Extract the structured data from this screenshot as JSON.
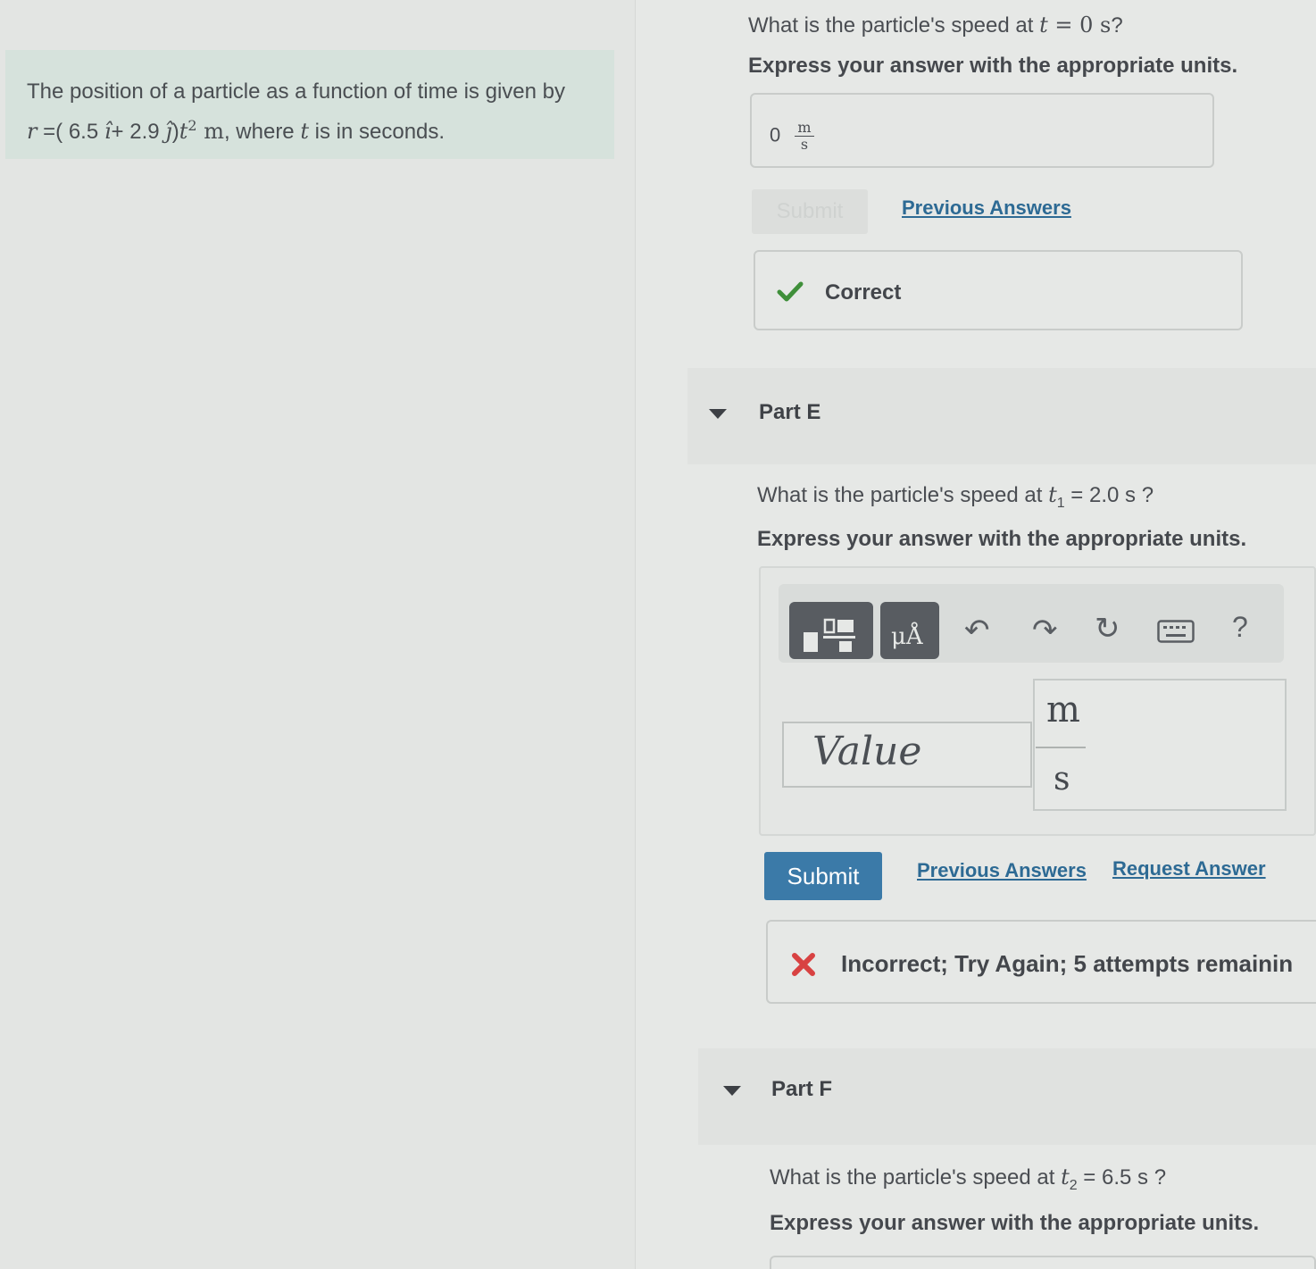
{
  "intro": {
    "line1": "The position of a particle as a function of time is given by",
    "r_symbol": "r",
    "eq_open": " =( 6.5 ",
    "i_hat": "î",
    "eq_mid": "+ 2.9 ",
    "j_hat": "ĵ",
    "eq_close": ")",
    "t_var": "t",
    "t_exp": "2",
    "unit_m": " m",
    "where_text": ", where ",
    "t_var2": "t",
    "tail": " is in seconds."
  },
  "part_d": {
    "question_pre": "What is the particle's speed at ",
    "question_var": "t",
    "question_eq": " = 0 s",
    "question_post": "?",
    "instruction": "Express your answer with the appropriate units.",
    "answer_value": "0",
    "answer_unit_num": "m",
    "answer_unit_den": "s",
    "submit_label": "Submit",
    "previous_answers_label": "Previous Answers",
    "feedback": "Correct"
  },
  "part_e": {
    "title": "Part E",
    "question_pre": "What is the particle's speed at ",
    "question_var": "t",
    "question_sub": "1",
    "question_post": " = 2.0 s ?",
    "instruction": "Express your answer with the appropriate units.",
    "toolbar": {
      "templates_icon": "templates-icon",
      "units_icon_label": "μÅ",
      "undo_icon": "↶",
      "redo_icon": "↷",
      "reset_icon": "↻",
      "keyboard_icon": "keyboard-icon",
      "help_icon": "?"
    },
    "value_placeholder": "Value",
    "unit_num": "m",
    "unit_den": "s",
    "submit_label": "Submit",
    "previous_answers_label": "Previous Answers",
    "request_answer_label": "Request Answer",
    "feedback": "Incorrect; Try Again; 5 attempts remainin"
  },
  "part_f": {
    "title": "Part F",
    "question_pre": "What is the particle's speed at ",
    "question_var": "t",
    "question_sub": "2",
    "question_post": " = 6.5 s ?",
    "instruction": "Express your answer with the appropriate units."
  },
  "colors": {
    "intro_bg": "#d6e2dc",
    "link": "#2d6a94",
    "submit_bg": "#3b7aa8",
    "correct": "#3f8f3a",
    "incorrect": "#d84242"
  }
}
